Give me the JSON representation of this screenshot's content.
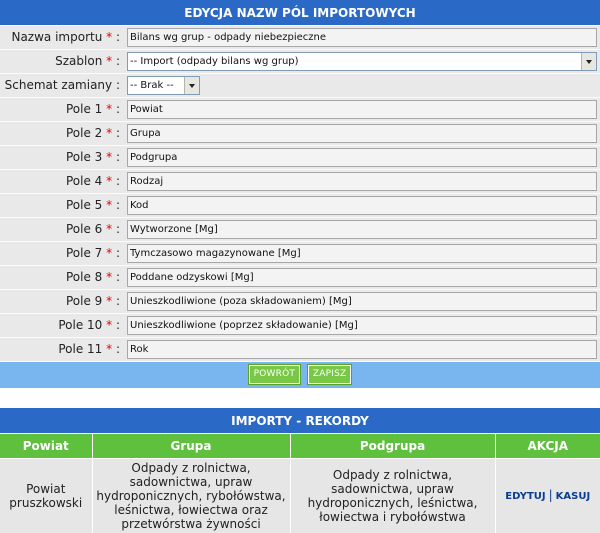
{
  "edit_form": {
    "title": "EDYCJA NAZW PÓL IMPORTOWYCH",
    "fields": [
      {
        "label": "Nazwa importu",
        "required": "*",
        "colon": " :",
        "value": "Bilans wg grup - odpady niebezpieczne"
      },
      {
        "label": "Szablon",
        "required": "*",
        "colon": " :",
        "value": "-- Import (odpady bilans wg grup)"
      },
      {
        "label": "Schemat zamiany",
        "required": "",
        "colon": " :",
        "value": "-- Brak --"
      },
      {
        "label": "Pole 1",
        "required": "*",
        "colon": " :",
        "value": "Powiat"
      },
      {
        "label": "Pole 2",
        "required": "*",
        "colon": " :",
        "value": "Grupa"
      },
      {
        "label": "Pole 3",
        "required": "*",
        "colon": " :",
        "value": "Podgrupa"
      },
      {
        "label": "Pole 4",
        "required": "*",
        "colon": " :",
        "value": "Rodzaj"
      },
      {
        "label": "Pole 5",
        "required": "*",
        "colon": " :",
        "value": "Kod"
      },
      {
        "label": "Pole 6",
        "required": "*",
        "colon": " :",
        "value": "Wytworzone [Mg]"
      },
      {
        "label": "Pole 7",
        "required": "*",
        "colon": " :",
        "value": "Tymczasowo magazynowane [Mg]"
      },
      {
        "label": "Pole 8",
        "required": "*",
        "colon": " :",
        "value": "Poddane odzyskowi [Mg]"
      },
      {
        "label": "Pole 9",
        "required": "*",
        "colon": " :",
        "value": "Unieszkodliwione (poza składowaniem) [Mg]"
      },
      {
        "label": "Pole 10",
        "required": "*",
        "colon": " :",
        "value": "Unieszkodliwione (poprzez składowanie) [Mg]"
      },
      {
        "label": "Pole 11",
        "required": "*",
        "colon": " :",
        "value": "Rok"
      }
    ],
    "buttons": {
      "back": "POWRÓT",
      "save": "ZAPISZ"
    }
  },
  "records": {
    "title": "IMPORTY - REKORDY",
    "columns": [
      "Powiat",
      "Grupa",
      "Podgrupa",
      "AKCJA"
    ],
    "rows": [
      {
        "powiat": "Powiat pruszkowski",
        "grupa": "Odpady z rolnictwa, sadownictwa, upraw hydroponicznych, rybołówstwa, leśnictwa, łowiectwa oraz przetwórstwa żywności",
        "podgrupa": "Odpady z rolnictwa, sadownictwa, upraw hydroponicznych, leśnictwa, łowiectwa i rybołówstwa",
        "edit": "EDYTUJ",
        "separator": "|",
        "delete": "KASUJ"
      }
    ]
  },
  "colors": {
    "header_blue": "#2a69c6",
    "button_bar_blue": "#79b6f0",
    "accent_green": "#5fc03e",
    "required_red": "#e00000"
  }
}
